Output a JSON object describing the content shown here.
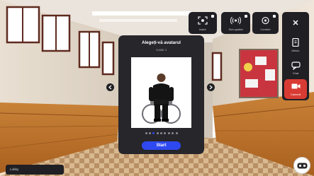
{
  "modal": {
    "title": "Alegeți-vă avatarul",
    "subtitle": "Avatar 1",
    "start_label": "Start",
    "page_total": 9,
    "page_active": 2
  },
  "top_buttons": [
    {
      "icon": "focus-icon",
      "label": "Ieșire"
    },
    {
      "icon": "broadcast-icon",
      "label": "Sub-spatial"
    },
    {
      "icon": "settings-icon",
      "label": "Comfort"
    }
  ],
  "side_buttons": [
    {
      "icon": "close-icon",
      "label": ""
    },
    {
      "icon": "tablet-icon",
      "label": "Meniu"
    },
    {
      "icon": "chat-icon",
      "label": "Chat"
    },
    {
      "icon": "camera-icon",
      "label": "Cameră"
    }
  ],
  "bottom_bar": {
    "label": "Lobby"
  },
  "colors": {
    "panel": "#26262b",
    "accent": "#2f49f0",
    "record_red": "#d83b33",
    "board_red": "#c9353f"
  }
}
